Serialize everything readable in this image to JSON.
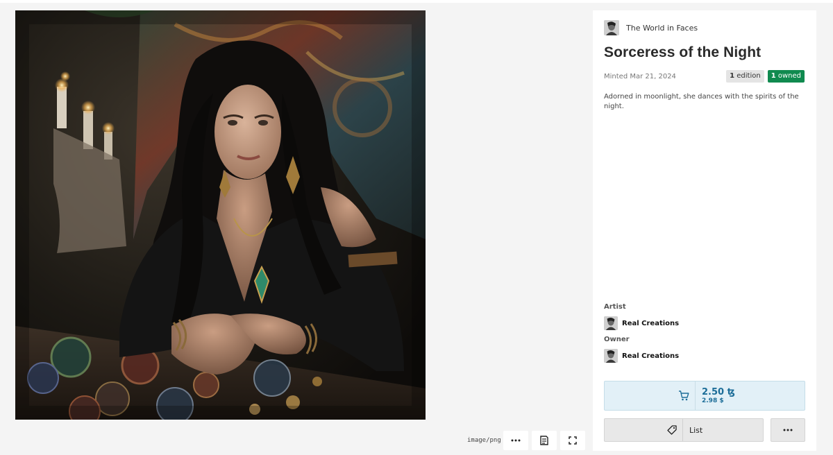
{
  "artwork": {
    "alt": "Sorceress of the Night artwork",
    "media_type": "image/png"
  },
  "toolbar": {
    "more_icon": "ellipsis-icon",
    "details_icon": "document-icon",
    "fullscreen_icon": "expand-icon"
  },
  "panel": {
    "collection_name": "The World in Faces",
    "title": "Sorceress of the Night",
    "minted": "Minted Mar 21, 2024",
    "edition_count": "1",
    "edition_label": "edition",
    "owned_count": "1",
    "owned_label": "owned",
    "description": "Adorned in moonlight, she dances with the spirits of the night.",
    "artist_label": "Artist",
    "artist_name": "Real Creations",
    "owner_label": "Owner",
    "owner_name": "Real Creations"
  },
  "buy": {
    "price": "2.50 ꜩ",
    "price_usd": "2.98 $",
    "icon": "cart-icon"
  },
  "list_button": {
    "label": "List",
    "icon": "tag-icon"
  },
  "colors": {
    "owned_badge": "#108a4f",
    "price_text": "#1c6d98",
    "buy_background": "#e2f0f7"
  }
}
